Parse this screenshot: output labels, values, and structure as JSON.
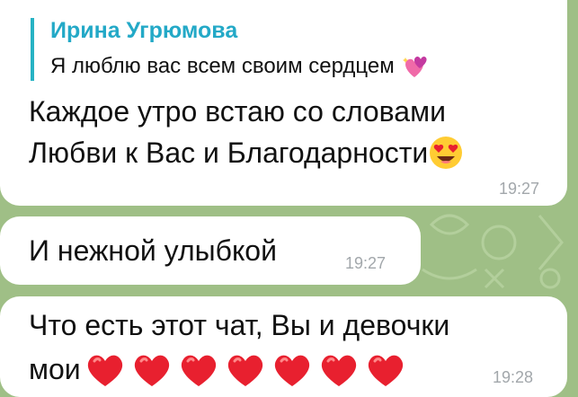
{
  "chat": {
    "messages": [
      {
        "reply": {
          "name": "Ирина Угрюмова",
          "text": "Я люблю вас всем своим сердцем",
          "emoji": "sparkling-hearts-icon"
        },
        "lines": [
          "Каждое утро встаю со словами",
          "Любви к Вас и Благодарности"
        ],
        "trailing_emoji": "heart-eyes-icon",
        "time": "19:27"
      },
      {
        "lines": [
          "И нежной улыбкой"
        ],
        "time": "19:27"
      },
      {
        "lines": [
          "Что есть этот чат, Вы и девочки",
          "мои"
        ],
        "trailing_emoji": "red-heart-icon",
        "trailing_emoji_count": 7,
        "time": "19:28"
      }
    ]
  },
  "colors": {
    "background": "#9fbf86",
    "bubble": "#ffffff",
    "reply_accent": "#23a9c7",
    "time": "#a2a7ab",
    "heart": "#e8202f"
  }
}
